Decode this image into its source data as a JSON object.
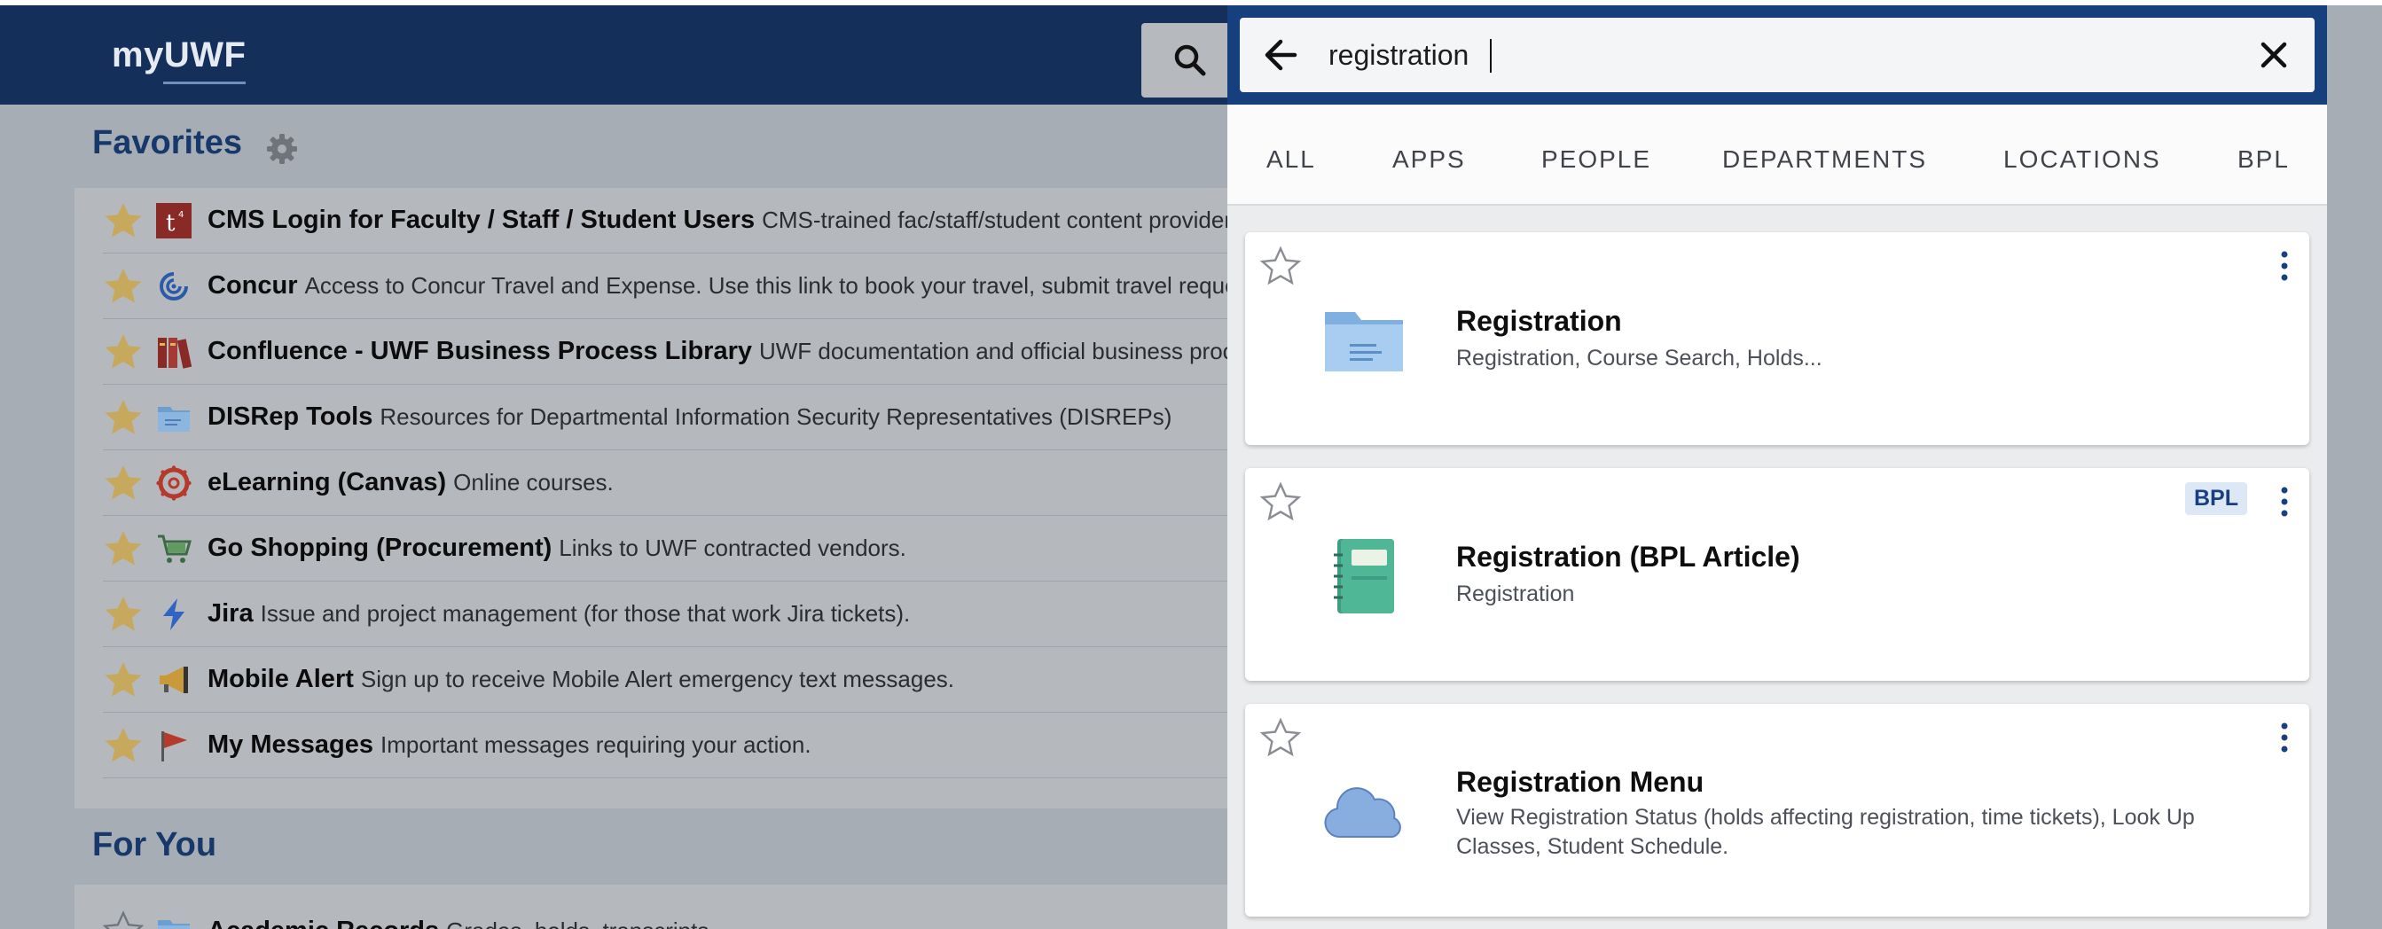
{
  "header": {
    "logo": "myUWF"
  },
  "favorites": {
    "title": "Favorites",
    "items": [
      {
        "name": "CMS Login for Faculty / Staff / Student Users",
        "desc": "CMS-trained fac/staff/student content providers",
        "icon": "t4-icon"
      },
      {
        "name": "Concur",
        "desc": "Access to Concur Travel and Expense. Use this link to book your travel, submit travel requests",
        "icon": "concur-icon"
      },
      {
        "name": "Confluence - UWF Business Process Library",
        "desc": "UWF documentation and official business process",
        "icon": "books-icon"
      },
      {
        "name": "DISRep Tools",
        "desc": "Resources for Departmental Information Security Representatives (DISREPs)",
        "icon": "folder-icon"
      },
      {
        "name": "eLearning (Canvas)",
        "desc": "Online courses.",
        "icon": "canvas-icon"
      },
      {
        "name": "Go Shopping (Procurement)",
        "desc": "Links to UWF contracted vendors.",
        "icon": "cart-icon"
      },
      {
        "name": "Jira",
        "desc": "Issue and project management (for those that work Jira tickets).",
        "icon": "jira-icon"
      },
      {
        "name": "Mobile Alert",
        "desc": "Sign up to receive Mobile Alert emergency text messages.",
        "icon": "megaphone-icon"
      },
      {
        "name": "My Messages",
        "desc": "Important messages requiring your action.",
        "icon": "flag-icon"
      }
    ]
  },
  "for_you": {
    "title": "For You",
    "first_item": "Academic Records",
    "first_item_desc": "Grades, holds, transcripts"
  },
  "search": {
    "query": "registration",
    "tabs": [
      "ALL",
      "APPS",
      "PEOPLE",
      "DEPARTMENTS",
      "LOCATIONS",
      "BPL"
    ],
    "results": [
      {
        "title": "Registration",
        "subtitle": "Registration, Course Search, Holds...",
        "icon": "folder-icon",
        "badge": ""
      },
      {
        "title": "Registration (BPL Article)",
        "subtitle": "Registration",
        "icon": "notebook-icon",
        "badge": "BPL"
      },
      {
        "title": "Registration Menu",
        "subtitle": "View Registration Status (holds affecting registration, time tickets), Look Up Classes, Student Schedule.",
        "icon": "cloud-icon",
        "badge": ""
      }
    ]
  },
  "colors": {
    "header_bg": "#16407d",
    "accent_star": "#d9b85a",
    "badge_bg": "#dde8f7"
  }
}
